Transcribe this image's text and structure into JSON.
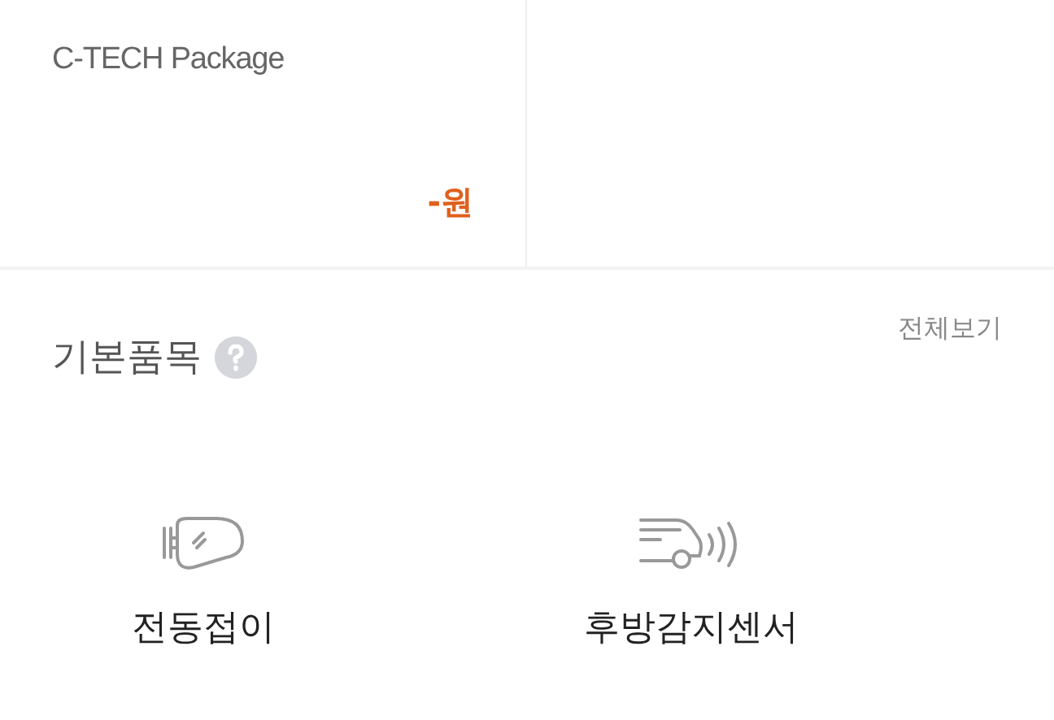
{
  "package_cards": [
    {
      "name": "C-TECH Package",
      "price": "-원"
    }
  ],
  "section": {
    "title": "기본품목",
    "view_all": "전체보기",
    "items": [
      {
        "label": "전동접이"
      },
      {
        "label": "후방감지센서"
      }
    ]
  }
}
